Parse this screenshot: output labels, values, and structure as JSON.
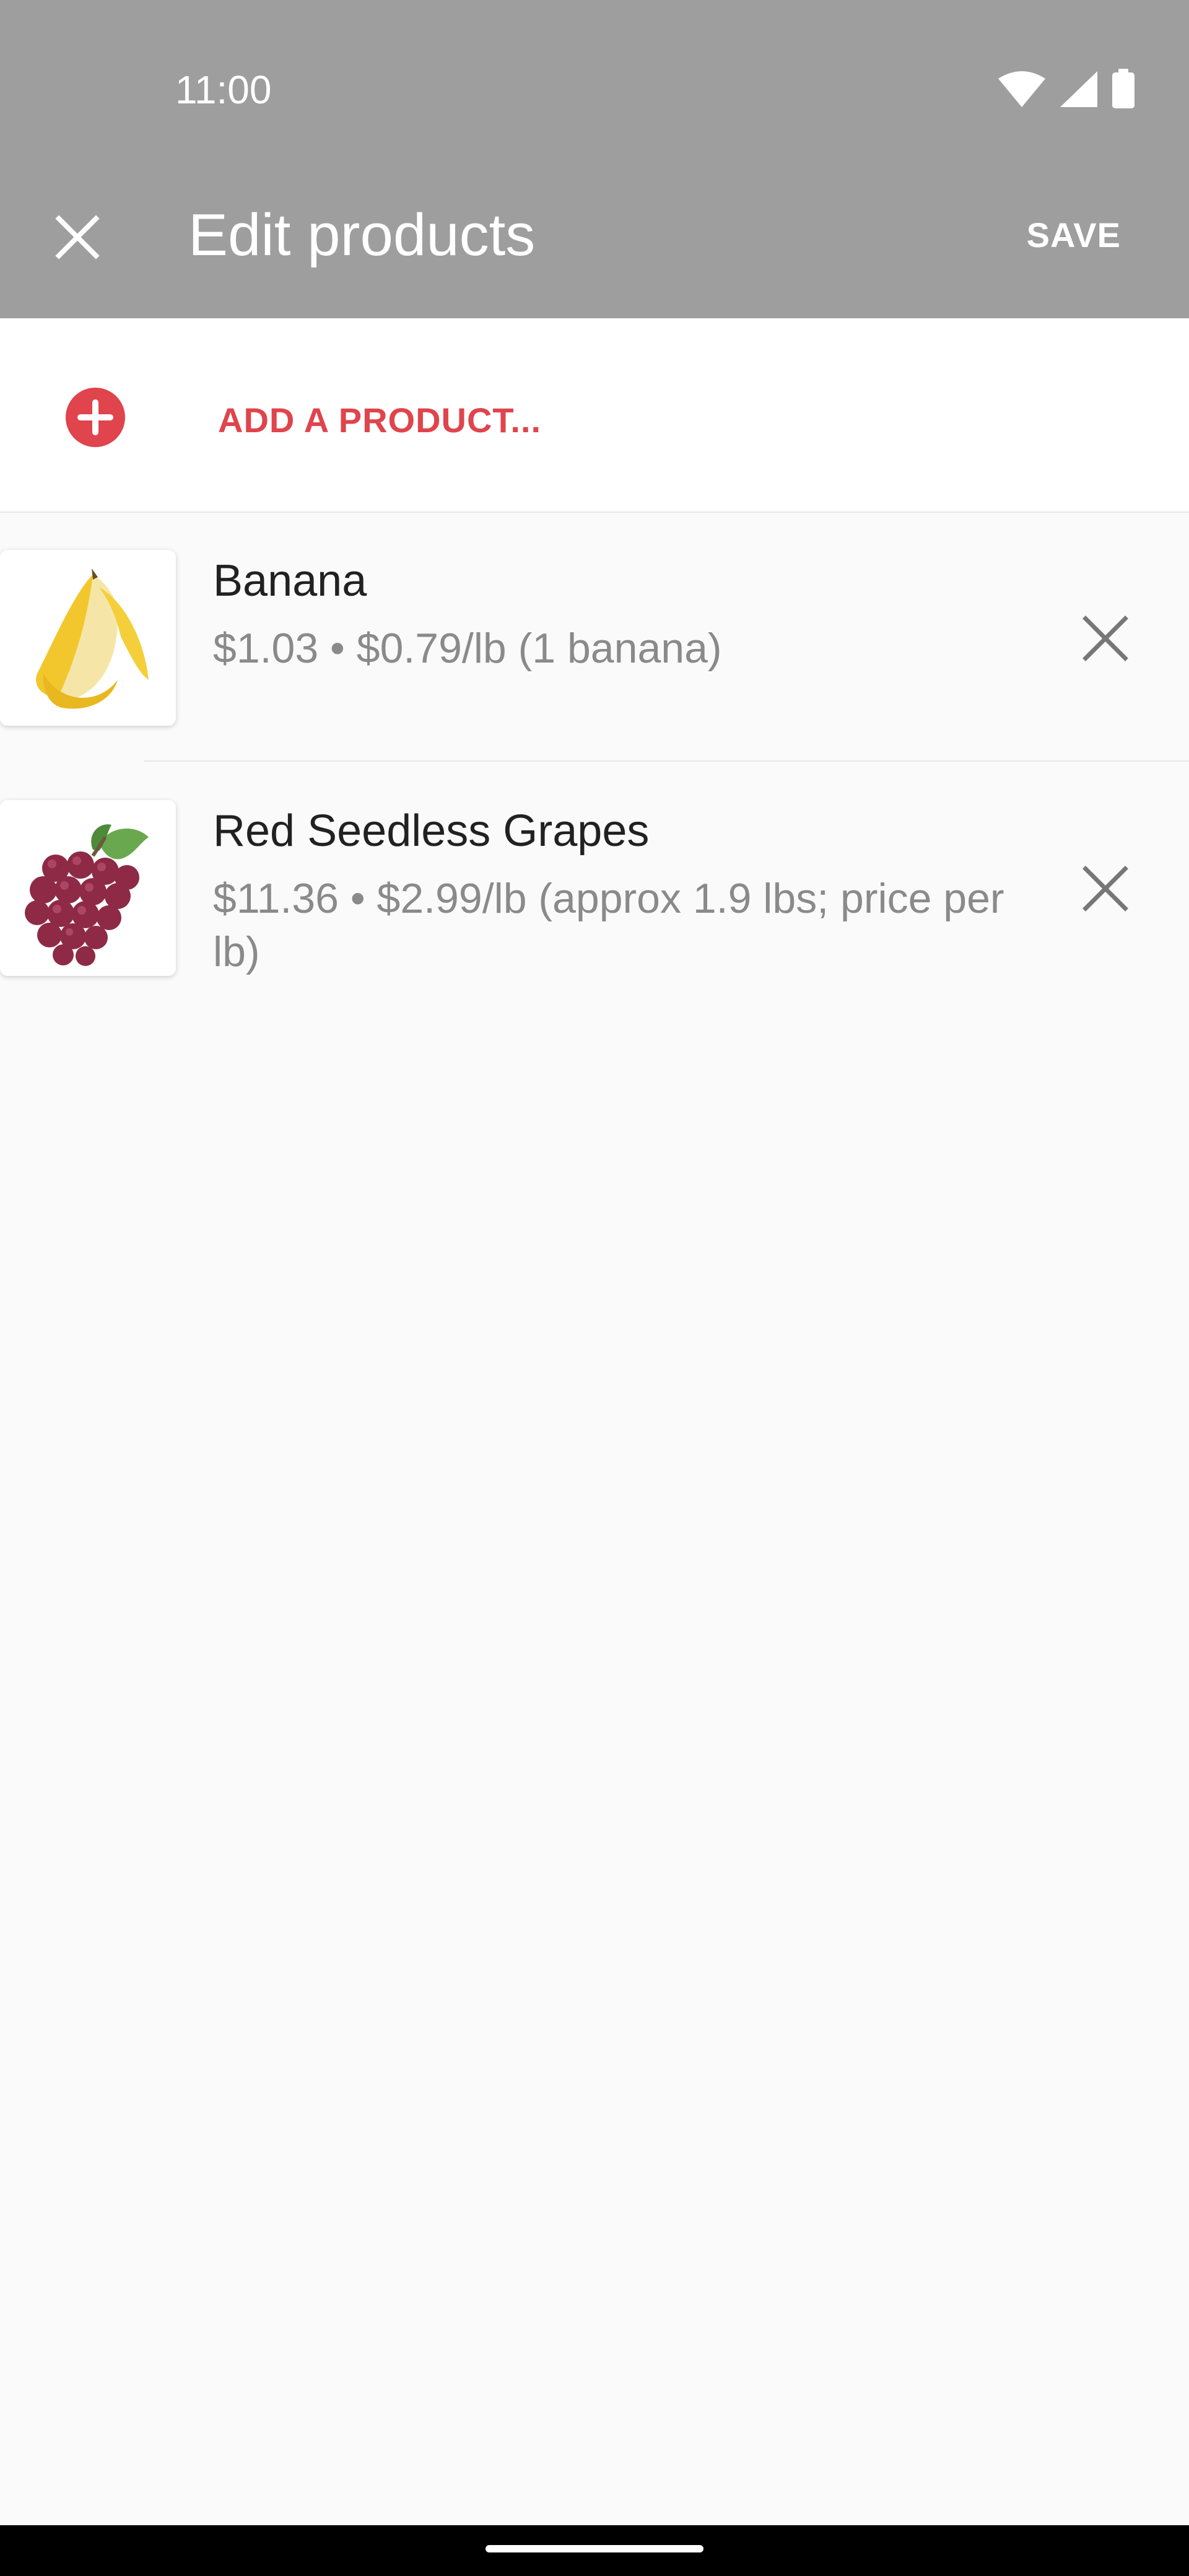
{
  "status_bar": {
    "time": "11:00",
    "icons": [
      "wifi-icon",
      "cellular-signal-icon",
      "battery-icon"
    ]
  },
  "app_bar": {
    "title": "Edit products",
    "save_label": "SAVE",
    "close_icon": "close-icon"
  },
  "add_product": {
    "label": "ADD A PRODUCT...",
    "icon": "add-circle-icon",
    "accent_color": "#e0444c"
  },
  "products": [
    {
      "name": "Banana",
      "description": "$1.03 • $0.79/lb (1 banana)",
      "image": "banana-image"
    },
    {
      "name": "Red Seedless Grapes",
      "description": "$11.36 • $2.99/lb (approx 1.9 lbs; price per lb)",
      "image": "grapes-image"
    }
  ],
  "colors": {
    "app_bar": "#9e9e9e",
    "background": "#fafafa",
    "accent": "#e0444c"
  }
}
